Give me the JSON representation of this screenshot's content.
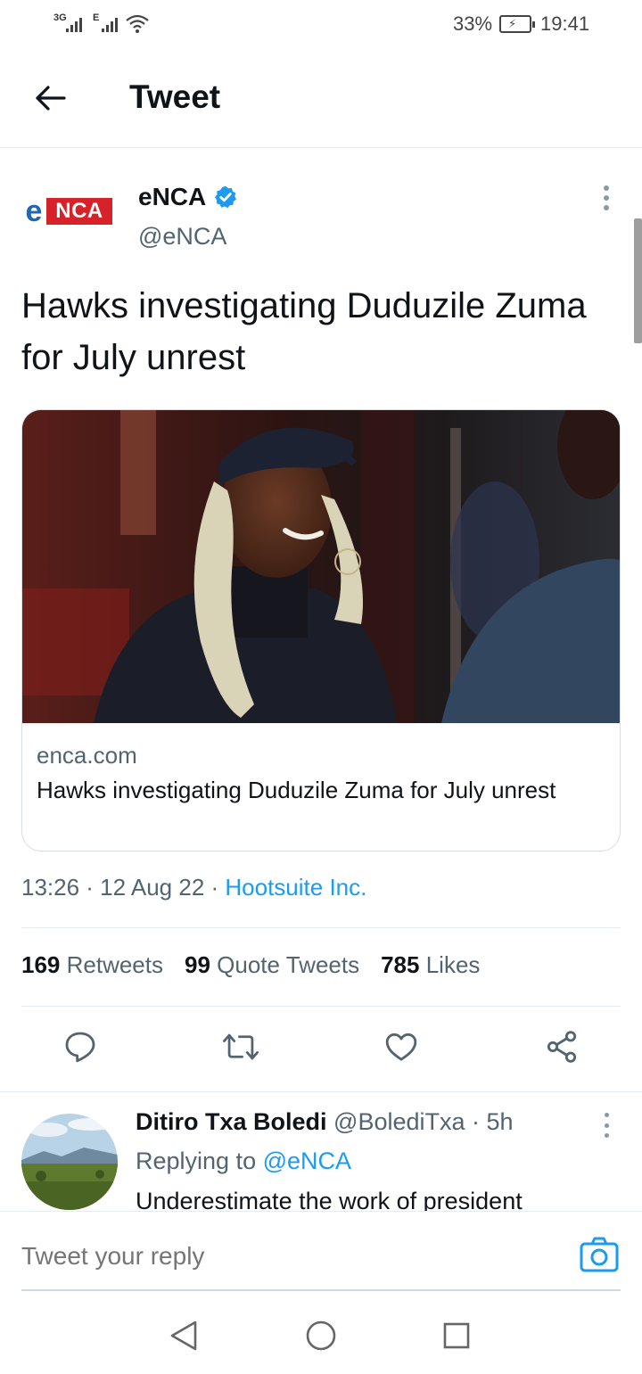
{
  "status_bar": {
    "network1": "3G",
    "network2": "E",
    "battery_percent": "33%",
    "time": "19:41"
  },
  "header": {
    "title": "Tweet",
    "back_icon": "arrow-left-icon"
  },
  "tweet": {
    "author_name": "eNCA",
    "author_handle": "@eNCA",
    "logo_letter": "e",
    "logo_text": "NCA",
    "verified": true,
    "text": "Hawks investigating Duduzile Zuma for July unrest",
    "card": {
      "domain": "enca.com",
      "title": "Hawks investigating Duduzile Zuma for July unrest"
    },
    "timestamp": "13:26 · 12 Aug 22 · ",
    "source": "Hootsuite Inc.",
    "stats": {
      "retweets_count": "169",
      "retweets_label": " Retweets",
      "quotes_count": "99",
      "quotes_label": " Quote Tweets",
      "likes_count": "785",
      "likes_label": " Likes"
    },
    "actions": [
      "reply-icon",
      "retweet-icon",
      "like-icon",
      "share-icon"
    ]
  },
  "reply": {
    "name": "Ditiro Txa Boledi",
    "handle": " @BolediTxa · 5h",
    "replying_prefix": "Replying to ",
    "replying_mention": "@eNCA",
    "text": "Underestimate the work of president"
  },
  "compose": {
    "placeholder": "Tweet your reply"
  },
  "colors": {
    "accent": "#1d9bf0",
    "brand_red": "#d6232a",
    "brand_blue": "#1f66b3"
  }
}
